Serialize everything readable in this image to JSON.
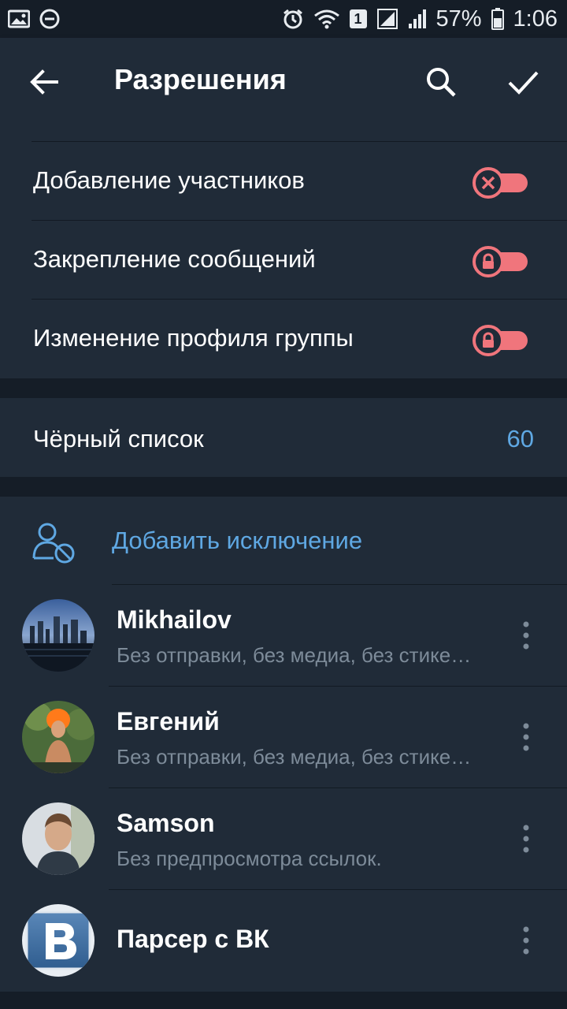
{
  "status_bar": {
    "sim_badge": "1",
    "battery": "57%",
    "time": "1:06",
    "icons": [
      "gallery-icon",
      "do-not-disturb-icon",
      "alarm-icon",
      "wifi-icon",
      "signal-icon",
      "battery-icon"
    ]
  },
  "appbar": {
    "title": "Разрешения",
    "icons": [
      "back-arrow-icon",
      "search-icon",
      "check-icon"
    ]
  },
  "permissions": [
    {
      "label": "Добавление участников",
      "state": "off",
      "icon": "close-icon"
    },
    {
      "label": "Закрепление сообщений",
      "state": "locked",
      "icon": "lock-icon"
    },
    {
      "label": "Изменение профиля группы",
      "state": "locked",
      "icon": "lock-icon"
    }
  ],
  "blacklist": {
    "label": "Чёрный список",
    "count": "60"
  },
  "exceptions": {
    "add_label": "Добавить исключение",
    "users": [
      {
        "name": "Mikhailov",
        "restriction": "Без отправки, без медиа, без стике…"
      },
      {
        "name": "Евгений",
        "restriction": "Без отправки, без медиа, без стике…"
      },
      {
        "name": "Samson",
        "restriction": "Без предпросмотра ссылок."
      },
      {
        "name": "Парсер с ВК",
        "restriction": ""
      }
    ]
  },
  "colors": {
    "background": "#151d27",
    "surface": "#202b38",
    "accent": "#5fa8e3",
    "toggle_red": "#f0757c",
    "secondary_text": "#7d8b99"
  }
}
